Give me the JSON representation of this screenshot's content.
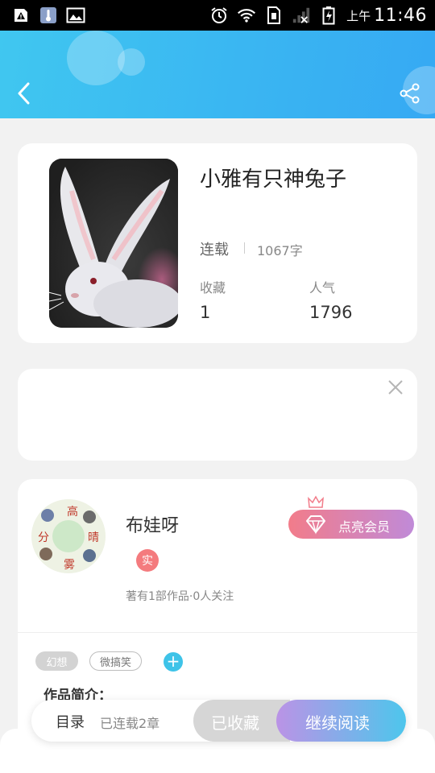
{
  "status_bar": {
    "ampm": "上午",
    "time": "11:46"
  },
  "book": {
    "title": "小雅有只神兔子",
    "status": "连载",
    "word_count": "1067字",
    "stats": [
      {
        "label": "收藏",
        "value": "1"
      },
      {
        "label": "人气",
        "value": "1796"
      }
    ]
  },
  "author": {
    "name": "布娃呀",
    "badge": "实",
    "meta": "著有1部作品·0人关注",
    "vip_label": "点亮会员",
    "tags": [
      "幻想",
      "微搞笑"
    ],
    "add_tag": "+",
    "intro_label": "作品简介："
  },
  "bottom_bar": {
    "toc_label": "目录",
    "toc_count": "已连载2章",
    "fav_label": "已收藏",
    "read_label": "继续阅读"
  },
  "avatar_chars": [
    "高",
    "分",
    "晴",
    "雾"
  ],
  "colors": {
    "header_start": "#40c7f0",
    "header_end": "#36a9f3",
    "vip_start": "#f27c8a",
    "vip_end": "#c08ad8",
    "read_start": "#bb93e6",
    "read_end": "#4dc6ec",
    "tag_add": "#3ec3e8",
    "badge": "#f47b7e"
  }
}
